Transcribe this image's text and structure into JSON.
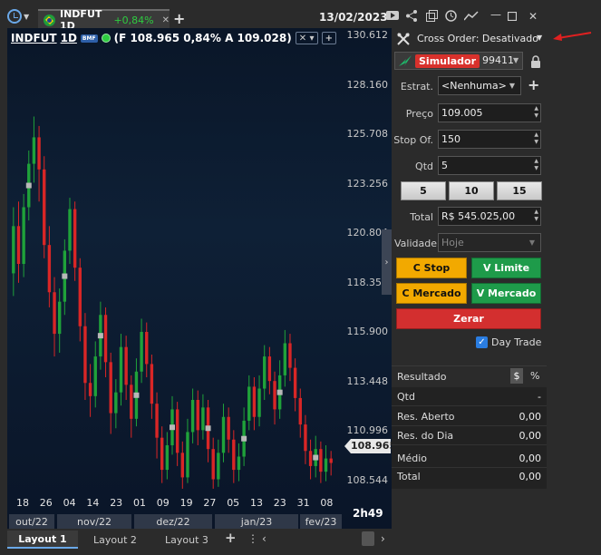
{
  "window": {
    "date": "13/02/2023"
  },
  "tab": {
    "symbol": "INDFUT 1D",
    "change": "+0,84%"
  },
  "chart": {
    "symbol": "INDFUT",
    "period": "1D",
    "badge": "BMF",
    "ohlc_text": "(F 108.965 0,84% A 109.028)",
    "current_price": "108.965",
    "time_remaining": "2h49",
    "price_axis": [
      "130.612",
      "128.160",
      "125.708",
      "123.256",
      "120.804",
      "118.352",
      "115.900",
      "113.448",
      "110.996",
      "108.544"
    ],
    "day_ticks": [
      "18",
      "26",
      "04",
      "14",
      "23",
      "01",
      "09",
      "19",
      "27",
      "05",
      "13",
      "23",
      "31",
      "08"
    ],
    "months": [
      "out/22",
      "nov/22",
      "dez/22",
      "jan/23",
      "fev/23"
    ],
    "colors": {
      "up": "#1fa23a",
      "down": "#d92626",
      "marker": "#b8b8b8"
    }
  },
  "chart_data": {
    "type": "candlestick",
    "ylim": [
      107500,
      131500
    ],
    "candles": [
      {
        "o": 119000,
        "c": 121500,
        "h": 122500,
        "l": 117800
      },
      {
        "o": 121500,
        "c": 119500,
        "h": 122800,
        "l": 118500
      },
      {
        "o": 119500,
        "c": 122500,
        "h": 123200,
        "l": 118800
      },
      {
        "o": 122500,
        "c": 124800,
        "h": 125500,
        "l": 121800
      },
      {
        "o": 124800,
        "c": 126200,
        "h": 127300,
        "l": 123800
      },
      {
        "o": 126200,
        "c": 124500,
        "h": 126800,
        "l": 122800
      },
      {
        "o": 124500,
        "c": 120500,
        "h": 125200,
        "l": 119800
      },
      {
        "o": 120500,
        "c": 118000,
        "h": 121500,
        "l": 117200
      },
      {
        "o": 118000,
        "c": 115800,
        "h": 118800,
        "l": 114600
      },
      {
        "o": 115800,
        "c": 117500,
        "h": 118200,
        "l": 114800
      },
      {
        "o": 117500,
        "c": 120200,
        "h": 120800,
        "l": 116800
      },
      {
        "o": 120200,
        "c": 122400,
        "h": 123000,
        "l": 119500
      },
      {
        "o": 122400,
        "c": 119300,
        "h": 122800,
        "l": 118600
      },
      {
        "o": 119300,
        "c": 116200,
        "h": 119800,
        "l": 115400
      },
      {
        "o": 116200,
        "c": 113200,
        "h": 116900,
        "l": 112300
      },
      {
        "o": 113200,
        "c": 112500,
        "h": 114200,
        "l": 111400
      },
      {
        "o": 112500,
        "c": 114600,
        "h": 115400,
        "l": 111900
      },
      {
        "o": 114600,
        "c": 116800,
        "h": 117500,
        "l": 113900
      },
      {
        "o": 116800,
        "c": 114300,
        "h": 117200,
        "l": 113500
      },
      {
        "o": 114300,
        "c": 111600,
        "h": 114800,
        "l": 110500
      },
      {
        "o": 111600,
        "c": 112700,
        "h": 113400,
        "l": 110800
      },
      {
        "o": 112700,
        "c": 115100,
        "h": 115800,
        "l": 112000
      },
      {
        "o": 115100,
        "c": 113100,
        "h": 115700,
        "l": 112300
      },
      {
        "o": 113100,
        "c": 111300,
        "h": 113600,
        "l": 110300
      },
      {
        "o": 111300,
        "c": 113800,
        "h": 114500,
        "l": 110900
      },
      {
        "o": 113800,
        "c": 115900,
        "h": 116600,
        "l": 113200
      },
      {
        "o": 115900,
        "c": 114200,
        "h": 116400,
        "l": 113500
      },
      {
        "o": 114200,
        "c": 112100,
        "h": 114700,
        "l": 111300
      },
      {
        "o": 112100,
        "c": 110300,
        "h": 112700,
        "l": 109200
      },
      {
        "o": 110300,
        "c": 108600,
        "h": 110900,
        "l": 107900
      },
      {
        "o": 108600,
        "c": 109900,
        "h": 110600,
        "l": 108100
      },
      {
        "o": 109900,
        "c": 111800,
        "h": 112500,
        "l": 109400
      },
      {
        "o": 111800,
        "c": 109500,
        "h": 112200,
        "l": 108800
      },
      {
        "o": 109500,
        "c": 108200,
        "h": 110100,
        "l": 107600
      },
      {
        "o": 108200,
        "c": 110600,
        "h": 111300,
        "l": 107900
      },
      {
        "o": 110600,
        "c": 112300,
        "h": 112900,
        "l": 110000
      },
      {
        "o": 112300,
        "c": 110700,
        "h": 112800,
        "l": 109900
      },
      {
        "o": 110700,
        "c": 111900,
        "h": 112600,
        "l": 110200
      },
      {
        "o": 111900,
        "c": 109700,
        "h": 112300,
        "l": 109000
      },
      {
        "o": 109700,
        "c": 108100,
        "h": 110300,
        "l": 107600
      },
      {
        "o": 108100,
        "c": 109500,
        "h": 110200,
        "l": 107700
      },
      {
        "o": 109500,
        "c": 111400,
        "h": 112100,
        "l": 109000
      },
      {
        "o": 111400,
        "c": 110200,
        "h": 111900,
        "l": 109500
      },
      {
        "o": 110200,
        "c": 108600,
        "h": 110700,
        "l": 107900
      },
      {
        "o": 108600,
        "c": 109300,
        "h": 110000,
        "l": 108000
      },
      {
        "o": 109300,
        "c": 111200,
        "h": 111900,
        "l": 108800
      },
      {
        "o": 111200,
        "c": 113000,
        "h": 113600,
        "l": 110700
      },
      {
        "o": 113000,
        "c": 111400,
        "h": 113500,
        "l": 110700
      },
      {
        "o": 111400,
        "c": 112900,
        "h": 113600,
        "l": 110900
      },
      {
        "o": 112900,
        "c": 114600,
        "h": 115200,
        "l": 112300
      },
      {
        "o": 114600,
        "c": 113300,
        "h": 115100,
        "l": 112600
      },
      {
        "o": 113300,
        "c": 111800,
        "h": 113800,
        "l": 111000
      },
      {
        "o": 111800,
        "c": 113600,
        "h": 114400,
        "l": 111300
      },
      {
        "o": 113600,
        "c": 115300,
        "h": 116000,
        "l": 113000
      },
      {
        "o": 115300,
        "c": 114000,
        "h": 115800,
        "l": 113300
      },
      {
        "o": 114000,
        "c": 112400,
        "h": 114500,
        "l": 111700
      },
      {
        "o": 112400,
        "c": 111000,
        "h": 112900,
        "l": 110300
      },
      {
        "o": 111000,
        "c": 109600,
        "h": 111500,
        "l": 108900
      },
      {
        "o": 109600,
        "c": 108800,
        "h": 110200,
        "l": 108100
      },
      {
        "o": 108800,
        "c": 109700,
        "h": 110400,
        "l": 108200
      },
      {
        "o": 109700,
        "c": 108500,
        "h": 110100,
        "l": 107900
      },
      {
        "o": 108500,
        "c": 109200,
        "h": 109900,
        "l": 108000
      },
      {
        "o": 109200,
        "c": 108965,
        "h": 109600,
        "l": 108300
      }
    ]
  },
  "order_panel": {
    "cross_order": "Cross Order: Desativado",
    "simulator": "Simulador",
    "account": "99411",
    "fields": {
      "estrat_label": "Estrat.",
      "estrat_value": "<Nenhuma>",
      "preco_label": "Preço",
      "preco_value": "109.005",
      "stop_label": "Stop Of.",
      "stop_value": "150",
      "qtd_label": "Qtd",
      "qtd_value": "5",
      "total_label": "Total",
      "total_value": "R$ 545.025,00",
      "validade_label": "Validade",
      "validade_value": "Hoje"
    },
    "qty_buttons": [
      "5",
      "10",
      "15"
    ],
    "buttons": {
      "c_stop": "C Stop",
      "v_limite": "V Limite",
      "c_mercado": "C Mercado",
      "v_mercado": "V Mercado",
      "zerar": "Zerar"
    },
    "day_trade": "Day Trade",
    "result": {
      "title": "Resultado",
      "dollar": "$",
      "percent": "%",
      "rows": [
        {
          "label": "Qtd",
          "value": "-"
        },
        {
          "label": "Res. Aberto",
          "value": "0,00"
        },
        {
          "label": "Res. do Dia",
          "value": "0,00"
        },
        {
          "label": "Médio",
          "value": "0,00"
        },
        {
          "label": "Total",
          "value": "0,00"
        }
      ]
    }
  },
  "layouts": [
    "Layout 1",
    "Layout 2",
    "Layout 3"
  ]
}
